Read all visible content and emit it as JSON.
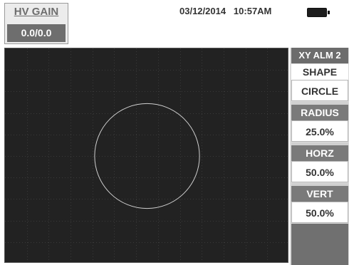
{
  "header": {
    "hv_gain_label": "HV GAIN",
    "hv_gain_value": "0.0/0.0",
    "date": "03/12/2014",
    "time": "10:57AM",
    "battery_icon": "battery-full-icon"
  },
  "menu": {
    "title": "XY ALM 2",
    "shape_label": "SHAPE",
    "shape_value": "CIRCLE",
    "radius_label": "RADIUS",
    "radius_value": "25.0%",
    "horz_label": "HORZ",
    "horz_value": "50.0%",
    "vert_label": "VERT",
    "vert_value": "50.0%"
  },
  "display": {
    "background": "#222222",
    "grid_color": "#3a3a3a",
    "alarm_color": "#cfcfcf",
    "alarm_shape": "circle",
    "alarm_radius_pct": 25.0,
    "alarm_horz_pct": 50.0,
    "alarm_vert_pct": 50.0
  }
}
